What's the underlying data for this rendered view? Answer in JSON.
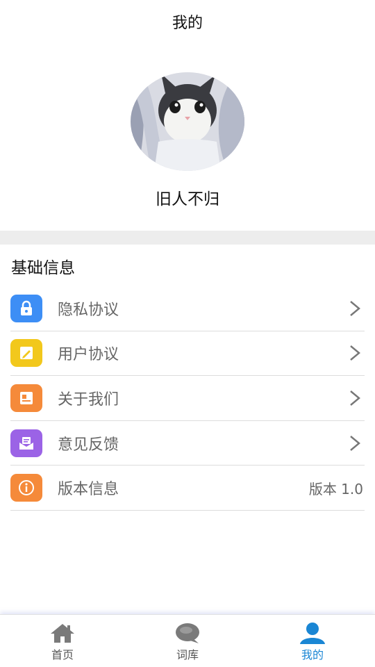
{
  "header": {
    "title": "我的"
  },
  "profile": {
    "username": "旧人不归"
  },
  "section": {
    "title": "基础信息"
  },
  "menu": {
    "items": [
      {
        "label": "隐私协议",
        "icon": "lock-icon",
        "color": "#3d8ef5"
      },
      {
        "label": "用户协议",
        "icon": "edit-note-icon",
        "color": "#f2c81c"
      },
      {
        "label": "关于我们",
        "icon": "document-icon",
        "color": "#f58a3a"
      },
      {
        "label": "意见反馈",
        "icon": "feedback-mail-icon",
        "color": "#9b63e6"
      },
      {
        "label": "版本信息",
        "icon": "info-icon",
        "color": "#f58a3a",
        "value": "版本 1.0"
      }
    ]
  },
  "tabbar": {
    "active_color": "#1a86d4",
    "items": [
      {
        "label": "首页",
        "icon": "home-icon"
      },
      {
        "label": "词库",
        "icon": "chat-bubble-icon"
      },
      {
        "label": "我的",
        "icon": "user-icon"
      }
    ]
  }
}
